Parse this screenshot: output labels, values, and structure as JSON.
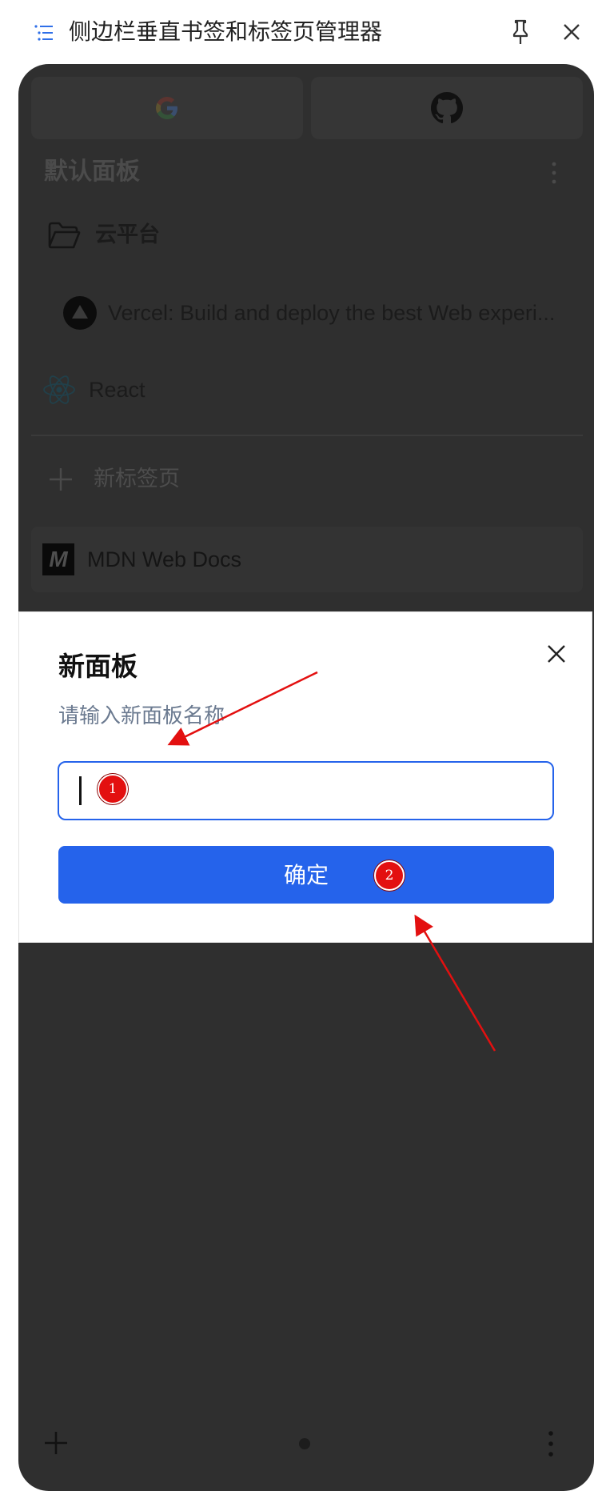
{
  "window": {
    "title": "侧边栏垂直书签和标签页管理器",
    "icons": {
      "app": "list-icon",
      "pin": "pin-icon",
      "close": "close-icon"
    }
  },
  "pinned_sites": [
    {
      "name": "google-icon"
    },
    {
      "name": "github-icon"
    }
  ],
  "board": {
    "title": "默认面板",
    "menu_icon": "more-vertical-icon",
    "folder": {
      "name": "云平台",
      "icon": "folder-icon"
    },
    "items": [
      {
        "icon": "vercel-icon",
        "title": "Vercel: Build and deploy the best Web experi..."
      },
      {
        "icon": "react-icon",
        "title": "React"
      }
    ],
    "new_tab_label": "新标签页",
    "tab": {
      "icon": "mdn-icon",
      "icon_glyph": "M",
      "title": "MDN Web Docs"
    }
  },
  "footer": {
    "add_icon": "plus-icon",
    "page_dot": "dot-indicator",
    "menu_icon": "more-vertical-icon"
  },
  "dialog": {
    "title": "新面板",
    "description": "请输入新面板名称",
    "input_value": "",
    "confirm_label": "确定",
    "close_icon": "close-icon"
  },
  "annotations": {
    "badges": [
      "1",
      "2"
    ],
    "color": "#e31010"
  },
  "colors": {
    "accent": "#2563eb",
    "overlay_panel": "#2f2f2f",
    "description": "#6b7a90"
  }
}
